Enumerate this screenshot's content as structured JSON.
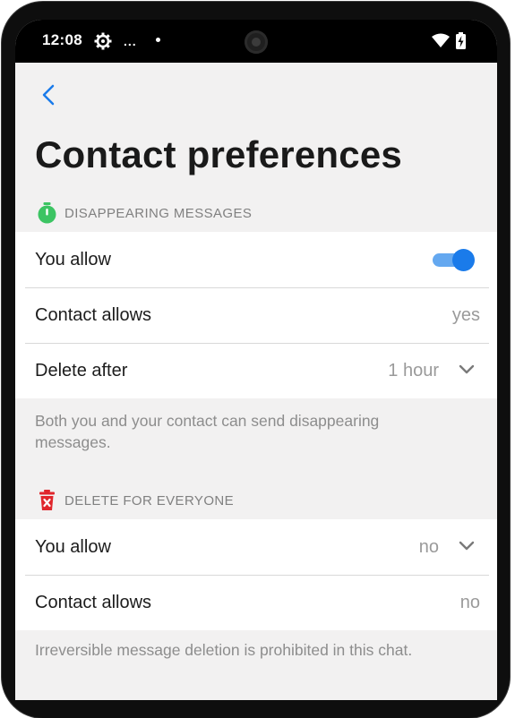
{
  "status_bar": {
    "time": "12:08",
    "dots": "...",
    "icons": [
      "gear-icon",
      "wifi-icon",
      "battery-charging-icon"
    ]
  },
  "header": {
    "back_icon": "chevron-left-icon",
    "title": "Contact preferences"
  },
  "sections": [
    {
      "icon": "timer-icon",
      "label": "DISAPPEARING MESSAGES",
      "rows": [
        {
          "name": "You allow",
          "toggle_on": true
        },
        {
          "name": "Contact allows",
          "value": "yes"
        },
        {
          "name": "Delete after",
          "value": "1 hour"
        }
      ],
      "note": "Both you and your contact can send disappearing messages."
    },
    {
      "icon": "trash-delete-icon",
      "label": "DELETE FOR EVERYONE",
      "rows": [
        {
          "name": "You allow",
          "value": "no"
        },
        {
          "name": "Contact allows",
          "value": "no"
        }
      ],
      "note": "Irreversible message deletion is prohibited in this chat."
    }
  ],
  "colors": {
    "accent": "#1a7bea",
    "timer_green": "#3cc463",
    "trash_red": "#e0262c",
    "background": "#f2f1f1"
  }
}
